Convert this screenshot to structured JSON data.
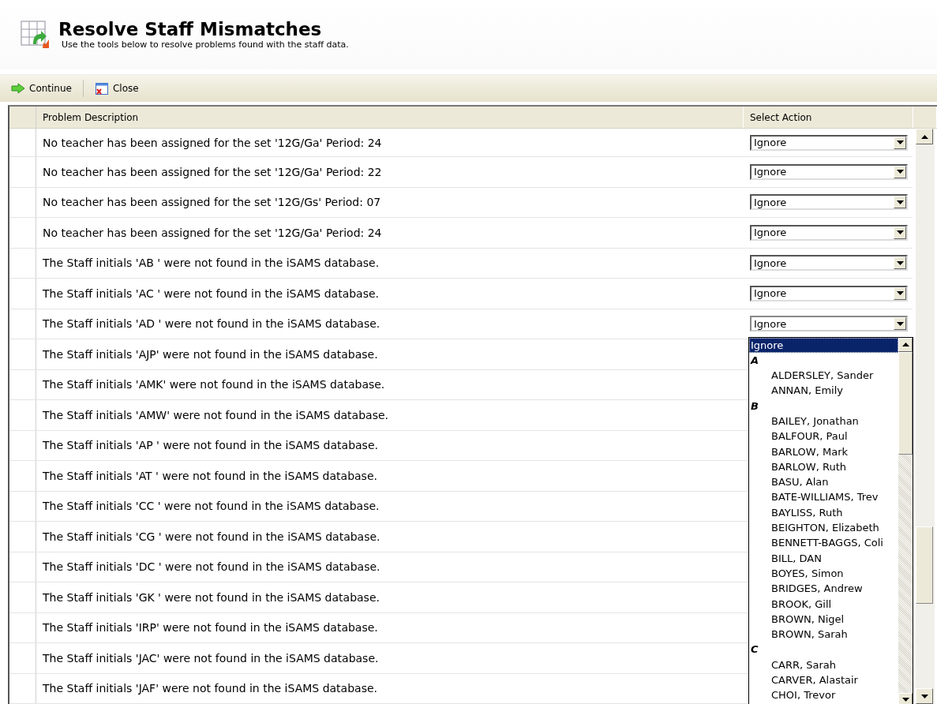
{
  "header": {
    "title": "Resolve Staff Mismatches",
    "subtitle": "Use the tools below to resolve problems found with the staff data."
  },
  "toolbar": [
    {
      "kind": "continue",
      "label": "Continue"
    },
    {
      "kind": "close",
      "label": "Close"
    }
  ],
  "table": {
    "columns": [
      "Problem Description",
      "Select Action"
    ],
    "rows": [
      {
        "description": "No teacher has been assigned for the set '12G/Ga' Period: 24",
        "action": "Ignore",
        "open": false
      },
      {
        "description": "No teacher has been assigned for the set '12G/Ga' Period: 22",
        "action": "Ignore",
        "open": false
      },
      {
        "description": "No teacher has been assigned for the set '12G/Gs' Period: 07",
        "action": "Ignore",
        "open": false
      },
      {
        "description": "No teacher has been assigned for the set '12G/Ga' Period: 24",
        "action": "Ignore",
        "open": false
      },
      {
        "description": "The Staff initials 'AB ' were not found in the iSAMS database.",
        "action": "Ignore",
        "open": false
      },
      {
        "description": "The Staff initials 'AC ' were not found in the iSAMS database.",
        "action": "Ignore",
        "open": false
      },
      {
        "description": "The Staff initials 'AD ' were not found in the iSAMS database.",
        "action": "Ignore",
        "open": true
      },
      {
        "description": "The Staff initials 'AJP' were not found in the iSAMS database."
      },
      {
        "description": "The Staff initials 'AMK' were not found in the iSAMS database."
      },
      {
        "description": "The Staff initials 'AMW' were not found in the iSAMS database."
      },
      {
        "description": "The Staff initials 'AP ' were not found in the iSAMS database."
      },
      {
        "description": "The Staff initials 'AT ' were not found in the iSAMS database."
      },
      {
        "description": "The Staff initials 'CC ' were not found in the iSAMS database."
      },
      {
        "description": "The Staff initials 'CG ' were not found in the iSAMS database."
      },
      {
        "description": "The Staff initials 'DC ' were not found in the iSAMS database."
      },
      {
        "description": "The Staff initials 'GK ' were not found in the iSAMS database."
      },
      {
        "description": "The Staff initials 'IRP' were not found in the iSAMS database."
      },
      {
        "description": "The Staff initials 'JAC' were not found in the iSAMS database."
      },
      {
        "description": "The Staff initials 'JAF' were not found in the iSAMS database."
      }
    ]
  },
  "dropdown_list": [
    {
      "kind": "option",
      "label": "Ignore",
      "selected": true
    },
    {
      "kind": "group",
      "label": "A"
    },
    {
      "kind": "option",
      "label": "ALDERSLEY, Sander",
      "selected": false
    },
    {
      "kind": "option",
      "label": "ANNAN, Emily",
      "selected": false
    },
    {
      "kind": "group",
      "label": "B"
    },
    {
      "kind": "option",
      "label": "BAILEY, Jonathan",
      "selected": false
    },
    {
      "kind": "option",
      "label": "BALFOUR, Paul",
      "selected": false
    },
    {
      "kind": "option",
      "label": "BARLOW, Mark",
      "selected": false
    },
    {
      "kind": "option",
      "label": "BARLOW, Ruth",
      "selected": false
    },
    {
      "kind": "option",
      "label": "BASU, Alan",
      "selected": false
    },
    {
      "kind": "option",
      "label": "BATE-WILLIAMS, Trev",
      "selected": false
    },
    {
      "kind": "option",
      "label": "BAYLISS, Ruth",
      "selected": false
    },
    {
      "kind": "option",
      "label": "BEIGHTON, Elizabeth",
      "selected": false
    },
    {
      "kind": "option",
      "label": "BENNETT-BAGGS, Coli",
      "selected": false
    },
    {
      "kind": "option",
      "label": "BILL, DAN",
      "selected": false
    },
    {
      "kind": "option",
      "label": "BOYES, Simon",
      "selected": false
    },
    {
      "kind": "option",
      "label": "BRIDGES, Andrew",
      "selected": false
    },
    {
      "kind": "option",
      "label": "BROOK, Gill",
      "selected": false
    },
    {
      "kind": "option",
      "label": "BROWN, Nigel",
      "selected": false
    },
    {
      "kind": "option",
      "label": "BROWN, Sarah",
      "selected": false
    },
    {
      "kind": "group",
      "label": "C"
    },
    {
      "kind": "option",
      "label": "CARR, Sarah",
      "selected": false
    },
    {
      "kind": "option",
      "label": "CARVER, Alastair",
      "selected": false
    },
    {
      "kind": "option",
      "label": "CHOI, Trevor",
      "selected": false
    }
  ]
}
